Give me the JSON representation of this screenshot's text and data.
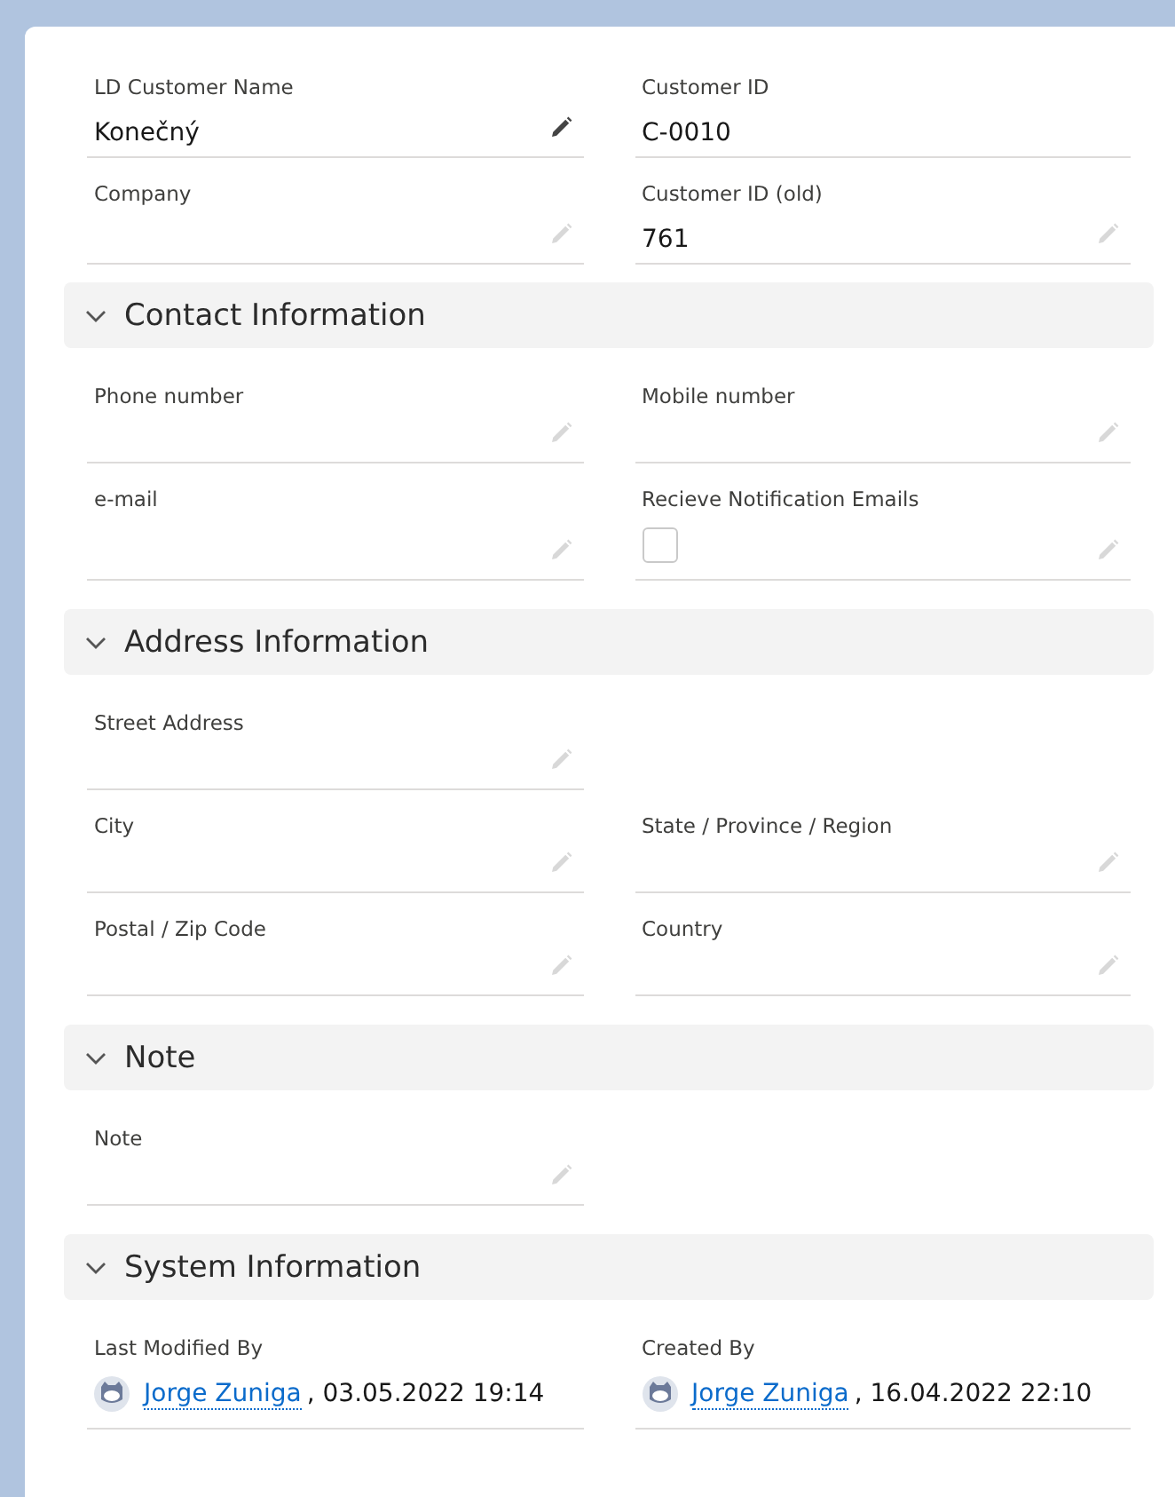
{
  "top_fields": [
    {
      "kind": "text",
      "label": "LD Customer Name",
      "value": "Konečný",
      "hovered": true
    },
    {
      "kind": "text",
      "label": "Customer ID",
      "value": "C-0010",
      "editable": false
    },
    {
      "kind": "text",
      "label": "Company",
      "hovered": false
    },
    {
      "kind": "text",
      "label": "Customer ID (old)",
      "value": "761",
      "hovered": false
    }
  ],
  "sections": [
    {
      "title": "Contact Information",
      "expanded": true,
      "fields": [
        {
          "kind": "text",
          "label": "Phone number",
          "hovered": false
        },
        {
          "kind": "text",
          "label": "Mobile number",
          "hovered": false
        },
        {
          "kind": "text",
          "label": "e-mail",
          "hovered": false
        },
        {
          "kind": "checkbox",
          "label": "Recieve Notification Emails",
          "checked": false,
          "hovered": false
        }
      ]
    },
    {
      "title": "Address Information",
      "expanded": true,
      "fields": [
        {
          "kind": "text",
          "label": "Street Address",
          "hovered": false
        },
        {
          "kind": "empty"
        },
        {
          "kind": "text",
          "label": "City",
          "hovered": false
        },
        {
          "kind": "text",
          "label": "State / Province / Region",
          "hovered": false
        },
        {
          "kind": "text",
          "label": "Postal / Zip Code",
          "hovered": false
        },
        {
          "kind": "text",
          "label": "Country",
          "hovered": false
        }
      ]
    },
    {
      "title": "Note",
      "expanded": true,
      "fields": [
        {
          "kind": "text",
          "label": "Note",
          "hovered": false
        }
      ]
    },
    {
      "title": "System Information",
      "expanded": true,
      "fields": [
        {
          "kind": "user",
          "label": "Last Modified By",
          "user": "Jorge Zuniga",
          "date": ", 03.05.2022 19:14",
          "editable": false
        },
        {
          "kind": "user",
          "label": "Created By",
          "user": "Jorge Zuniga",
          "date": ", 16.04.2022 22:10",
          "editable": false
        }
      ]
    }
  ]
}
